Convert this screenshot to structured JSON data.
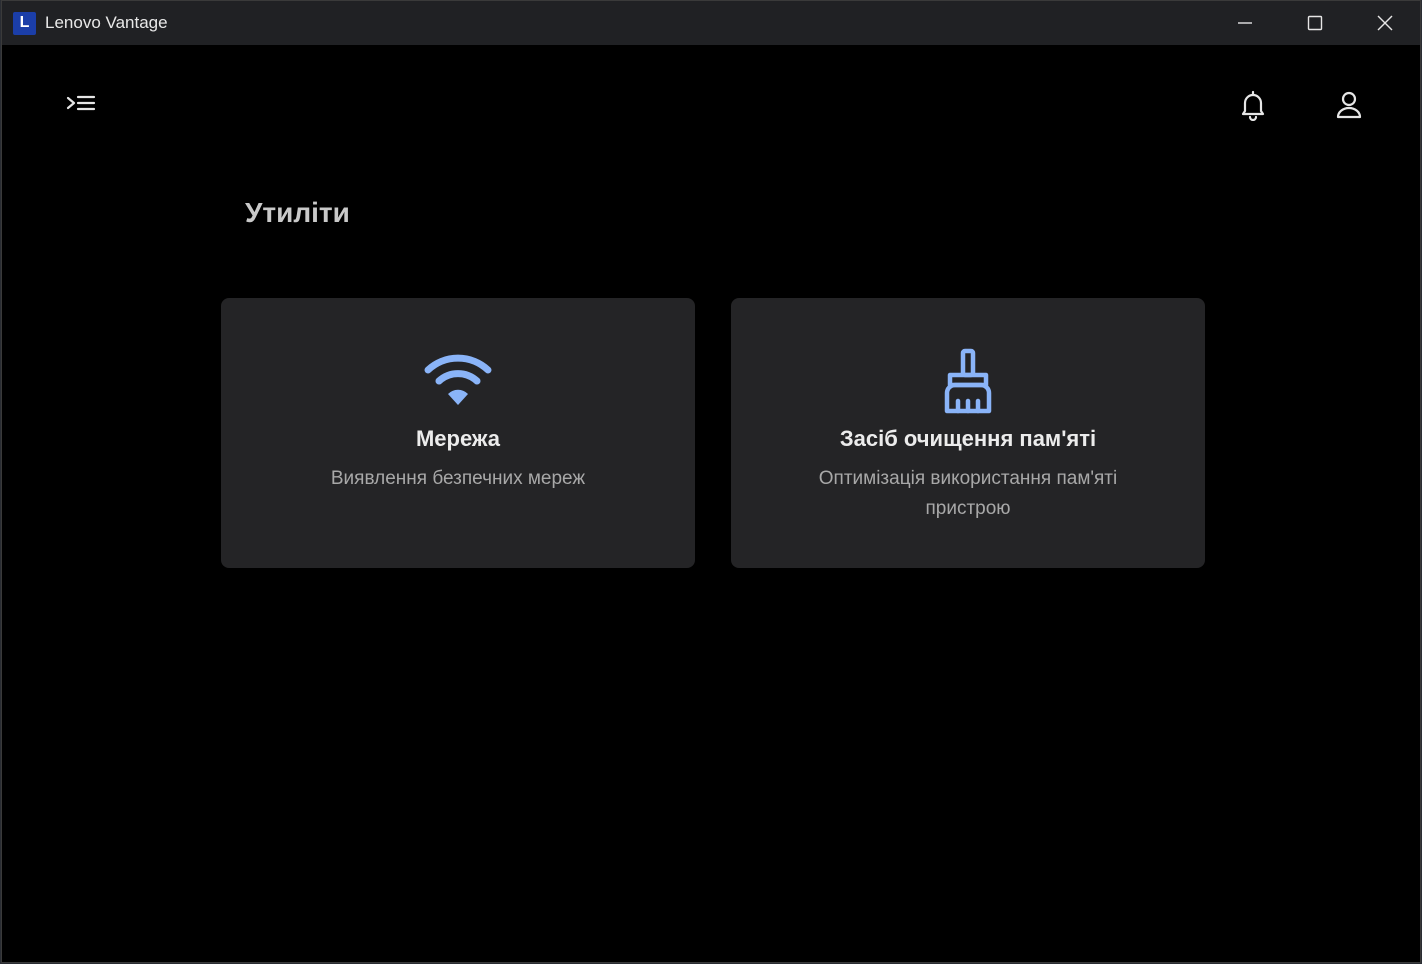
{
  "titlebar": {
    "logo_letter": "L",
    "app_title": "Lenovo Vantage"
  },
  "header": {
    "menu_icon": "menu-expand-icon",
    "notifications_icon": "bell-icon",
    "account_icon": "user-icon"
  },
  "page": {
    "title": "Утиліти"
  },
  "cards": [
    {
      "icon": "wifi-icon",
      "title": "Мережа",
      "description": "Виявлення безпечних мереж"
    },
    {
      "icon": "broom-icon",
      "title": "Засіб очищення пам'яті",
      "description": "Оптимізація використання пам'яті пристрою"
    }
  ],
  "colors": {
    "accent_icon": "#8ab4f8",
    "card_background": "#242426",
    "window_background": "#000000"
  }
}
